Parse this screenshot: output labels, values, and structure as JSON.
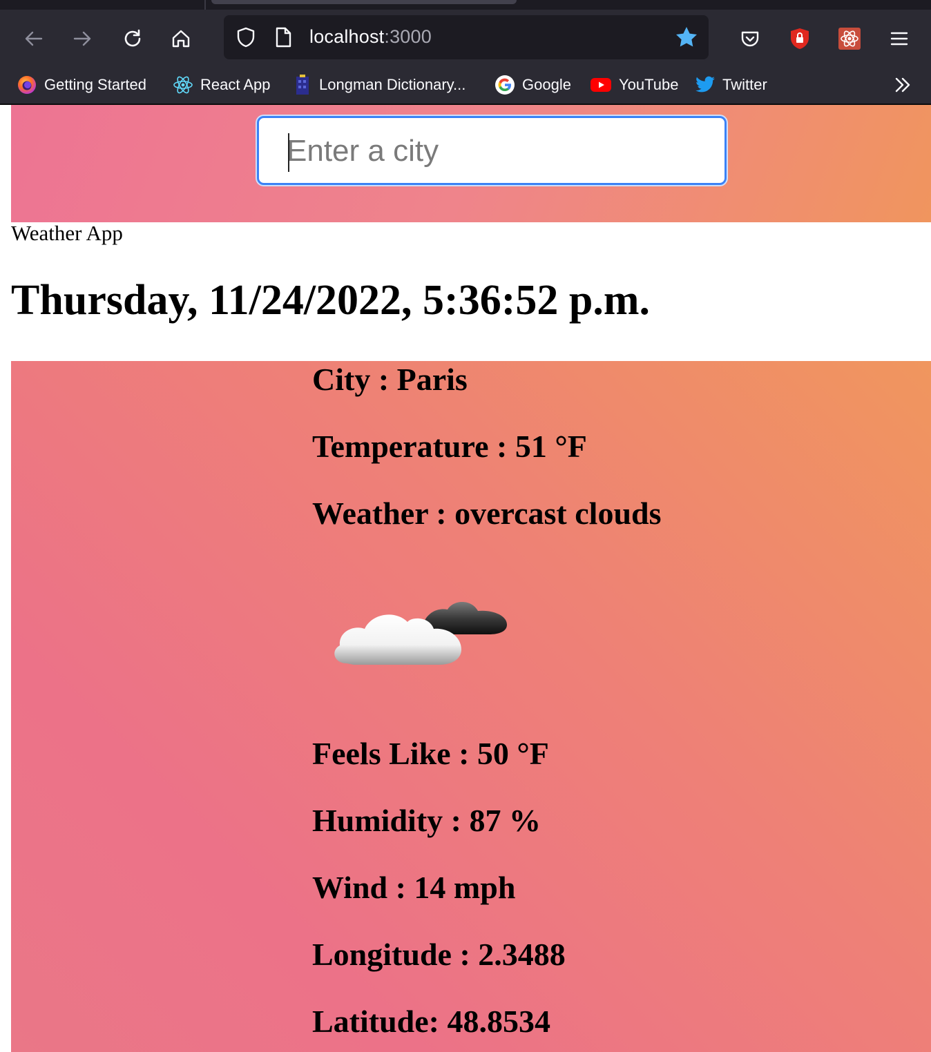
{
  "browser": {
    "url_host": "localhost",
    "url_port": ":3000",
    "bookmarks": [
      {
        "label": "Getting Started",
        "icon": "firefox-icon"
      },
      {
        "label": "React App",
        "icon": "react-icon"
      },
      {
        "label": "Longman Dictionary...",
        "icon": "longman-icon"
      },
      {
        "label": "Google",
        "icon": "google-icon"
      },
      {
        "label": "YouTube",
        "icon": "youtube-icon"
      },
      {
        "label": "Twitter",
        "icon": "twitter-icon"
      }
    ],
    "colors": {
      "chrome": "#2b2a33",
      "urlbar": "#1c1b22",
      "star": "#54b4f5"
    }
  },
  "search": {
    "placeholder": "Enter a city",
    "value": ""
  },
  "app": {
    "title": "Weather App",
    "datetime": "Thursday, 11/24/2022, 5:36:52 p.m."
  },
  "weather": {
    "city": "City : Paris",
    "temperature": "Temperature : 51 °F",
    "description": "Weather : overcast clouds",
    "icon": "overcast-clouds-icon",
    "feels_like": "Feels Like : 50 °F",
    "humidity": "Humidity : 87 %",
    "wind": "Wind : 14 mph",
    "longitude": "Longitude : 2.3488",
    "latitude": "Latitude: 48.8534"
  }
}
